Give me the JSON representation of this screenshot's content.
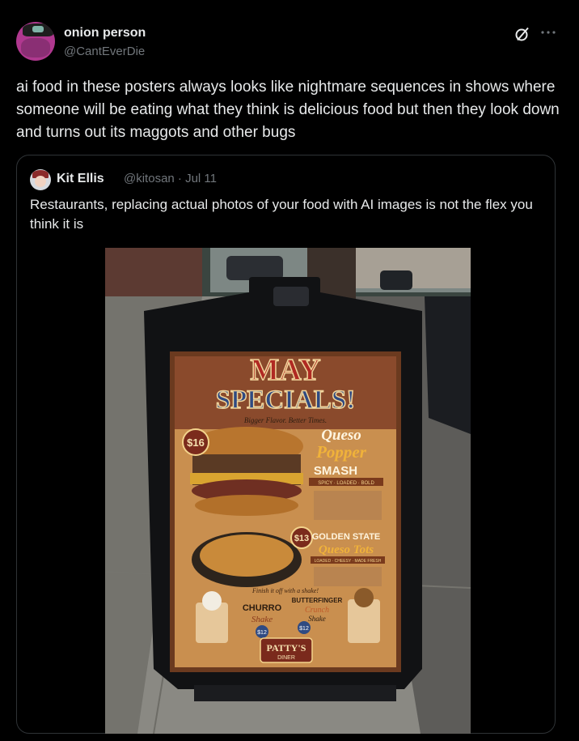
{
  "tweet": {
    "author": {
      "name": "onion person",
      "handle": "@CantEverDie"
    },
    "more_icon": "more-horizontal-icon",
    "grok_icon": "grok-icon",
    "text": "ai food in these posters always looks like nightmare sequences in shows where someone will be eating what they think is delicious food but then they look down and turns out its maggots and other bugs"
  },
  "quote": {
    "author": {
      "name": "Kit Ellis",
      "handle": "@kitosan · Jul 11"
    },
    "text": "Restaurants, replacing actual photos of your food with AI images is not the flex you think it is",
    "image": {
      "title_line1": "MAY",
      "title_line2": "SPECIALS!",
      "tagline": "Bigger Flavor. Better Times.",
      "item1": {
        "price": "$16",
        "name1": "Queso",
        "name2": "Popper",
        "name3": "SMASH",
        "tags": "SPICY · LOADED · BOLD"
      },
      "item2": {
        "price": "$13",
        "name1": "GOLDEN STATE",
        "name2": "Queso Tots",
        "tags": "LOADED · CHEESY · MADE FRESH"
      },
      "finish": "Finish it off with a shake!",
      "shake1": {
        "name1": "CHURRO",
        "name2": "Shake",
        "price": "$12"
      },
      "shake2": {
        "name1": "BUTTERFINGER",
        "name2": "Crunch",
        "name3": "Shake",
        "price": "$12"
      },
      "brand_line1": "PATTY'S",
      "brand_line2": "DINER"
    }
  }
}
